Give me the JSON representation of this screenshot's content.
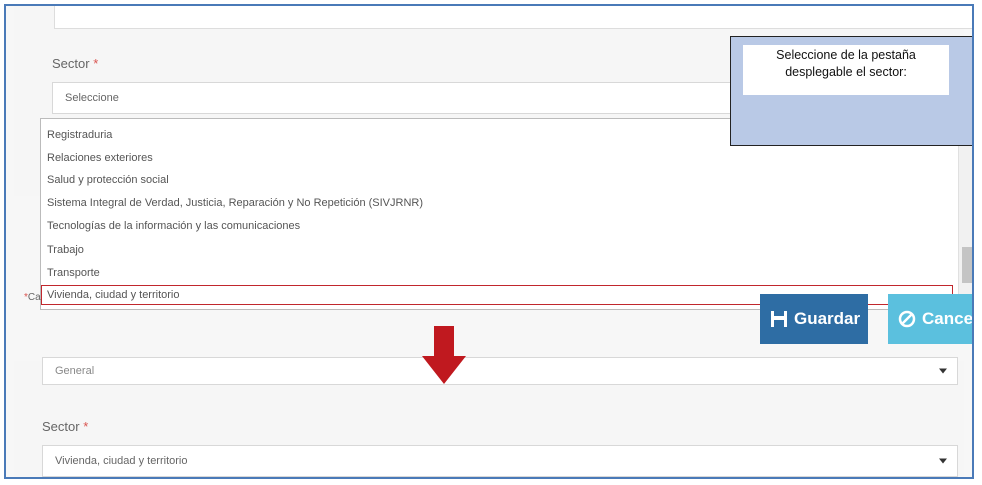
{
  "callout": {
    "text": "Seleccione de la pestaña desplegable el sector:"
  },
  "top_form": {
    "sector_label": "Sector",
    "required_mark": "*",
    "select_placeholder": "Seleccione"
  },
  "dropdown": {
    "options": [
      "Registraduria",
      "Relaciones exteriores",
      "Salud y protección social",
      "Sistema Integral de Verdad, Justicia, Reparación y No Repetición (SIVJRNR)",
      "Tecnologías de la información y las comunicaciones",
      "Trabajo",
      "Transporte"
    ],
    "selected_option": "Vivienda, ciudad y territorio"
  },
  "partial_label": {
    "required_mark": "*",
    "text": "Ca"
  },
  "buttons": {
    "save_label": "Guardar",
    "cancel_label": "Cancela"
  },
  "bottom_form": {
    "type_value": "General",
    "sector_label": "Sector",
    "required_mark": "*",
    "sector_value": "Vivienda, ciudad y territorio"
  },
  "colors": {
    "frame_border": "#4a7ab8",
    "save_button": "#2e6da4",
    "cancel_button": "#5bc0de",
    "arrow": "#c0191f",
    "callout_bg": "#b9c9e6",
    "highlight_border": "#c1272d"
  },
  "icons": {
    "save": "floppy-disk-icon",
    "cancel": "ban-icon",
    "arrow": "down-arrow-icon"
  }
}
